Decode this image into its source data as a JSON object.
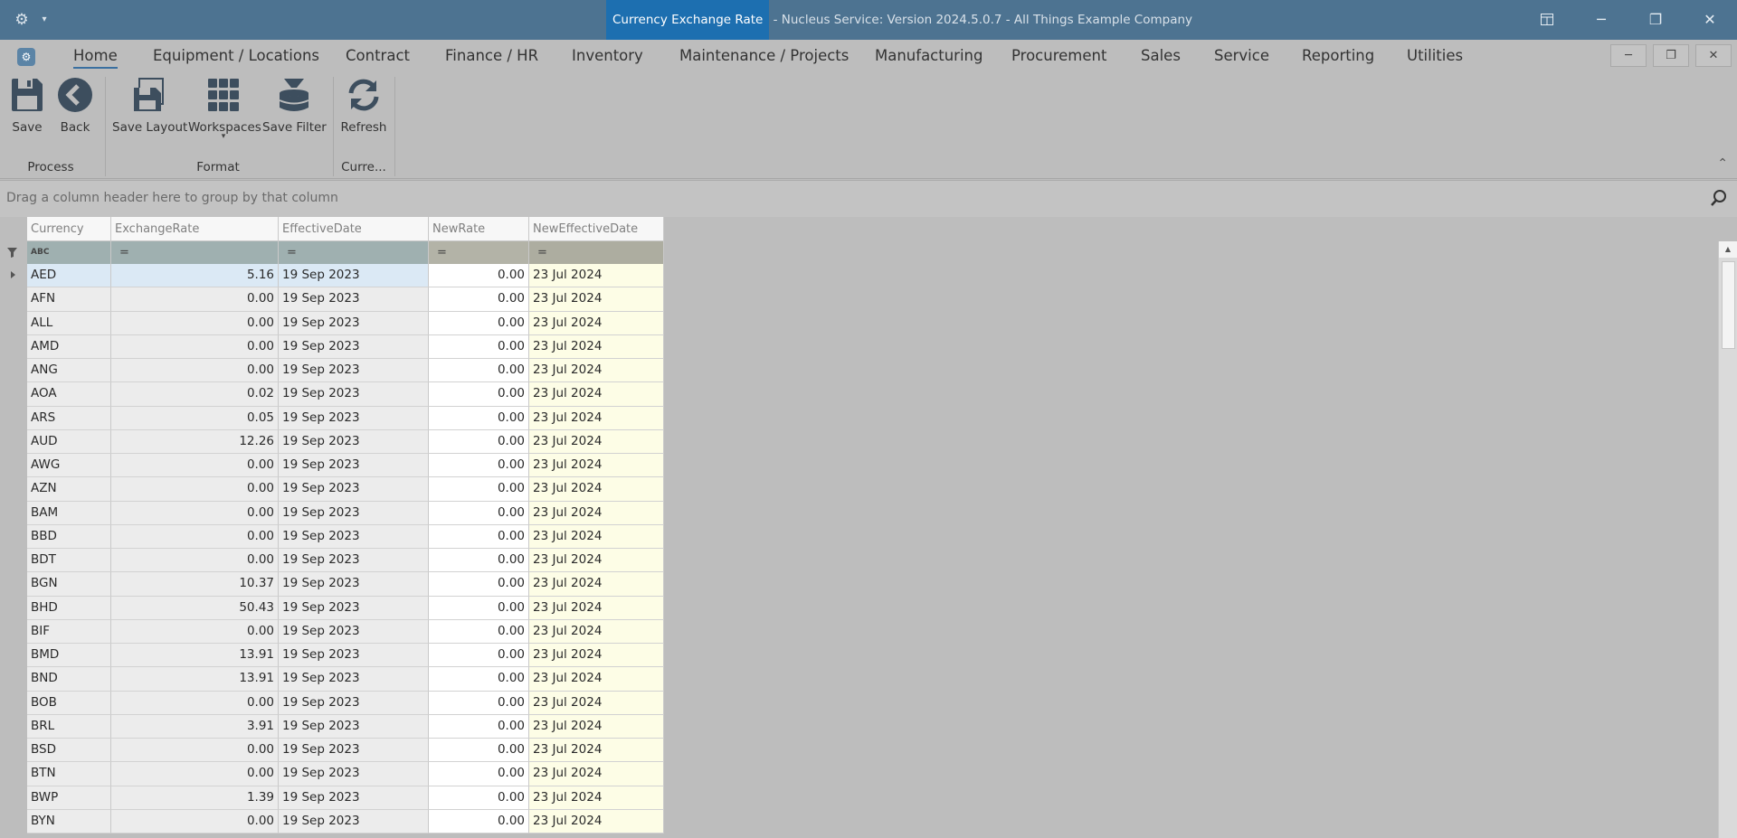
{
  "window": {
    "title_highlight": "Currency Exchange Rate",
    "title_rest": " - Nucleus Service: Version 2024.5.0.7 - All Things Example Company"
  },
  "menu": {
    "items": [
      "Home",
      "Equipment / Locations",
      "Contract",
      "Finance / HR",
      "Inventory",
      "Maintenance / Projects",
      "Manufacturing",
      "Procurement",
      "Sales",
      "Service",
      "Reporting",
      "Utilities"
    ],
    "active": "Home"
  },
  "ribbon": {
    "buttons": {
      "save": "Save",
      "back": "Back",
      "save_layout": "Save Layout",
      "workspaces": "Workspaces",
      "save_filter": "Save Filter",
      "refresh": "Refresh"
    },
    "groups": {
      "process": "Process",
      "format": "Format",
      "current": "Curre..."
    }
  },
  "group_panel": {
    "hint": "Drag a column header here to group by that column"
  },
  "grid": {
    "columns": [
      "Currency",
      "ExchangeRate",
      "EffectiveDate",
      "NewRate",
      "NewEffectiveDate"
    ],
    "filter_glyphs": {
      "text": "ABC",
      "equals": "="
    },
    "rows": [
      [
        "AED",
        "5.16",
        "19 Sep 2023",
        "0.00",
        "23 Jul 2024"
      ],
      [
        "AFN",
        "0.00",
        "19 Sep 2023",
        "0.00",
        "23 Jul 2024"
      ],
      [
        "ALL",
        "0.00",
        "19 Sep 2023",
        "0.00",
        "23 Jul 2024"
      ],
      [
        "AMD",
        "0.00",
        "19 Sep 2023",
        "0.00",
        "23 Jul 2024"
      ],
      [
        "ANG",
        "0.00",
        "19 Sep 2023",
        "0.00",
        "23 Jul 2024"
      ],
      [
        "AOA",
        "0.02",
        "19 Sep 2023",
        "0.00",
        "23 Jul 2024"
      ],
      [
        "ARS",
        "0.05",
        "19 Sep 2023",
        "0.00",
        "23 Jul 2024"
      ],
      [
        "AUD",
        "12.26",
        "19 Sep 2023",
        "0.00",
        "23 Jul 2024"
      ],
      [
        "AWG",
        "0.00",
        "19 Sep 2023",
        "0.00",
        "23 Jul 2024"
      ],
      [
        "AZN",
        "0.00",
        "19 Sep 2023",
        "0.00",
        "23 Jul 2024"
      ],
      [
        "BAM",
        "0.00",
        "19 Sep 2023",
        "0.00",
        "23 Jul 2024"
      ],
      [
        "BBD",
        "0.00",
        "19 Sep 2023",
        "0.00",
        "23 Jul 2024"
      ],
      [
        "BDT",
        "0.00",
        "19 Sep 2023",
        "0.00",
        "23 Jul 2024"
      ],
      [
        "BGN",
        "10.37",
        "19 Sep 2023",
        "0.00",
        "23 Jul 2024"
      ],
      [
        "BHD",
        "50.43",
        "19 Sep 2023",
        "0.00",
        "23 Jul 2024"
      ],
      [
        "BIF",
        "0.00",
        "19 Sep 2023",
        "0.00",
        "23 Jul 2024"
      ],
      [
        "BMD",
        "13.91",
        "19 Sep 2023",
        "0.00",
        "23 Jul 2024"
      ],
      [
        "BND",
        "13.91",
        "19 Sep 2023",
        "0.00",
        "23 Jul 2024"
      ],
      [
        "BOB",
        "0.00",
        "19 Sep 2023",
        "0.00",
        "23 Jul 2024"
      ],
      [
        "BRL",
        "3.91",
        "19 Sep 2023",
        "0.00",
        "23 Jul 2024"
      ],
      [
        "BSD",
        "0.00",
        "19 Sep 2023",
        "0.00",
        "23 Jul 2024"
      ],
      [
        "BTN",
        "0.00",
        "19 Sep 2023",
        "0.00",
        "23 Jul 2024"
      ],
      [
        "BWP",
        "1.39",
        "19 Sep 2023",
        "0.00",
        "23 Jul 2024"
      ],
      [
        "BYN",
        "0.00",
        "19 Sep 2023",
        "0.00",
        "23 Jul 2024"
      ]
    ],
    "selected_row": 0
  },
  "colors": {
    "titlebar": "#4d7391",
    "title_highlight": "#1d6fb0",
    "background": "#bdbdbd",
    "new_effective_date_cell": "#fdfde6",
    "selected_row": "#dbe9f5"
  }
}
